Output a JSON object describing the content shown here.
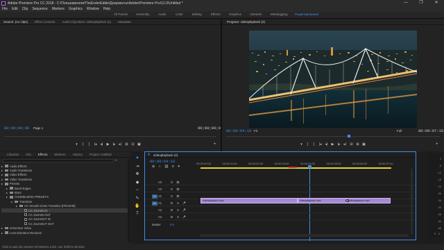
{
  "window": {
    "title": "Adobe Premiere Pro CC 2018 - C:\\Пользователи\\TheEnderEddie\\Документы\\Adobe\\Premiere Pro\\12.0\\Untitled *",
    "controls": [
      "—",
      "❐",
      "✕"
    ]
  },
  "menu": [
    "File",
    "Edit",
    "Clip",
    "Sequence",
    "Markers",
    "Graphics",
    "Window",
    "Help"
  ],
  "workspaces": {
    "tabs": [
      "All Panels",
      "Assembly",
      "Audio",
      "Color",
      "Editing",
      "Effects",
      "Graphics",
      "Libraries",
      "Metalogging",
      "Редактирование"
    ],
    "active": "Редактирование"
  },
  "source_panel": {
    "tabs": [
      "Source: (no clips)",
      "Effect Controls",
      "Audio Clip Mixer: videoplayback (2)",
      "Metadata"
    ],
    "timecode_left": "00;00;00;00",
    "page": "Page 1",
    "timecode_right": "00;00;00;00",
    "controls": [
      "▾",
      "{",
      "}",
      "|◂",
      "◂|",
      "▶",
      "|▸",
      "▸|",
      "⊞",
      "⊡",
      "▣",
      "+"
    ]
  },
  "program_panel": {
    "tab": "Program: videoplayback (2)",
    "timecode_left": "00:00:04:10",
    "fit": "Fit",
    "quality": "Full",
    "timecode_right": "00:00:07:15",
    "controls": [
      "▾",
      "{",
      "}",
      "|◂",
      "◂|",
      "▶",
      "|▸",
      "▸|",
      "⊟",
      "⊞",
      "▣",
      "+"
    ]
  },
  "project_panel": {
    "tabs": [
      "Libraries",
      "Info",
      "Effects",
      "Markers",
      "History",
      "Project: Untitled"
    ],
    "active_tab": "Effects",
    "items": [
      {
        "label": "Audio Effects",
        "depth": 0,
        "kind": "folder"
      },
      {
        "label": "Audio Transitions",
        "depth": 0,
        "kind": "folder"
      },
      {
        "label": "Video Effects",
        "depth": 0,
        "kind": "folder"
      },
      {
        "label": "Video Transitions",
        "depth": 0,
        "kind": "folder"
      },
      {
        "label": "Presets",
        "depth": 0,
        "kind": "folder"
      },
      {
        "label": "Bevel Edges",
        "depth": 1,
        "kind": "folder"
      },
      {
        "label": "Blurs",
        "depth": 1,
        "kind": "folder"
      },
      {
        "label": "CHOMEUZHIK PRESETS",
        "depth": 1,
        "kind": "folder"
      },
      {
        "label": "Transition",
        "depth": 2,
        "kind": "folder"
      },
      {
        "label": "CC Smooth Zoom Transition [PR/AE/M]",
        "depth": 3,
        "kind": "folder"
      },
      {
        "label": "CC ZoomIN IN",
        "depth": 4,
        "kind": "clip",
        "selected": true
      },
      {
        "label": "CC ZoomIN OUT",
        "depth": 4,
        "kind": "clip"
      },
      {
        "label": "CC ZoomOUT IN",
        "depth": 4,
        "kind": "clip"
      },
      {
        "label": "CC ZoomOUT OUT",
        "depth": 4,
        "kind": "clip"
      },
      {
        "label": "Immersive Video",
        "depth": 0,
        "kind": "folder"
      },
      {
        "label": "Lens Distortion Removal",
        "depth": 0,
        "kind": "folder"
      }
    ]
  },
  "tools": [
    {
      "name": "selection-tool-icon",
      "glyph": "▲"
    },
    {
      "name": "track-select-tool-icon",
      "glyph": "⇥"
    },
    {
      "name": "ripple-edit-tool-icon",
      "glyph": "✥"
    },
    {
      "name": "razor-tool-icon",
      "glyph": "◆"
    },
    {
      "name": "slip-tool-icon",
      "glyph": "↔"
    },
    {
      "name": "pen-tool-icon",
      "glyph": "✎"
    },
    {
      "name": "hand-tool-icon",
      "glyph": "✋"
    },
    {
      "name": "type-tool-icon",
      "glyph": "T"
    }
  ],
  "timeline": {
    "tab": "videoplayback (2)",
    "timecode": "00:00:04:10",
    "ruler": [
      "00:00:00:00",
      "00:00:01:00",
      "00:00:02:00",
      "00:00:03:00",
      "00:00:04:00",
      "00:00:05:00",
      "00:00:06:00",
      "00:00:07:00"
    ],
    "video_tracks": [
      {
        "label": "V3",
        "buttons": [
          "⊡",
          "👁"
        ]
      },
      {
        "label": "V2",
        "buttons": [
          "⊡",
          "👁"
        ]
      },
      {
        "label": "V1",
        "buttons": [
          "⊡",
          "👁"
        ]
      }
    ],
    "audio_tracks": [
      {
        "label": "A1",
        "buttons": [
          "M",
          "S",
          "🎤"
        ]
      },
      {
        "label": "A2",
        "buttons": [
          "M",
          "S",
          "🎤"
        ]
      },
      {
        "label": "A3",
        "buttons": [
          "M",
          "S",
          "🎤"
        ]
      }
    ],
    "source_toggle_v": "V1",
    "source_toggle_a": "A1",
    "master": {
      "label": "Master",
      "value": "0.0"
    },
    "clips": [
      "videoplayback.mp4",
      "videoplayback.mp4",
      "videoplayback.mp4"
    ]
  },
  "audio_meter": {
    "labels": [
      "0",
      "-6",
      "-12",
      "-18",
      "-24",
      "-30",
      "-36",
      "-42",
      "-48",
      "-54",
      "dB"
    ],
    "solo": [
      "S",
      "S"
    ]
  },
  "status": "Click to add clip markers All Markers a link, use Shift for all tools."
}
